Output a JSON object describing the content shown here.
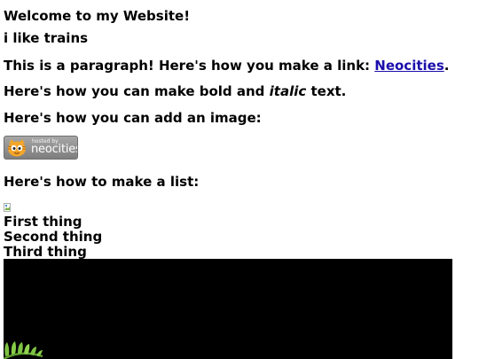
{
  "page": {
    "welcome": "Welcome to my Website!",
    "tagline": "i like trains",
    "link_prefix": "This is a paragraph! Here's how you make a link: ",
    "link_text": "Neocities",
    "link_suffix": ".",
    "bold_prefix": "Here's how you can make bold and ",
    "italic_word": "italic",
    "bold_suffix": " text.",
    "image_heading": "Here's how you can add an image:",
    "list_heading": "Here's how to make a list:"
  },
  "badge": {
    "small_text": "hosted by",
    "name": "neocities"
  },
  "list": {
    "items": [
      "First thing",
      "Second thing",
      "Third thing"
    ]
  },
  "colors": {
    "link": "#1a0dab",
    "badge_bg": "#8f8f8f",
    "video_bg": "#000000",
    "fern_green": "#7dc242"
  },
  "icons": {
    "badge": "neocities-cat-icon",
    "bullet": "broken-image-icon",
    "media": "fern-leaf-icon"
  }
}
